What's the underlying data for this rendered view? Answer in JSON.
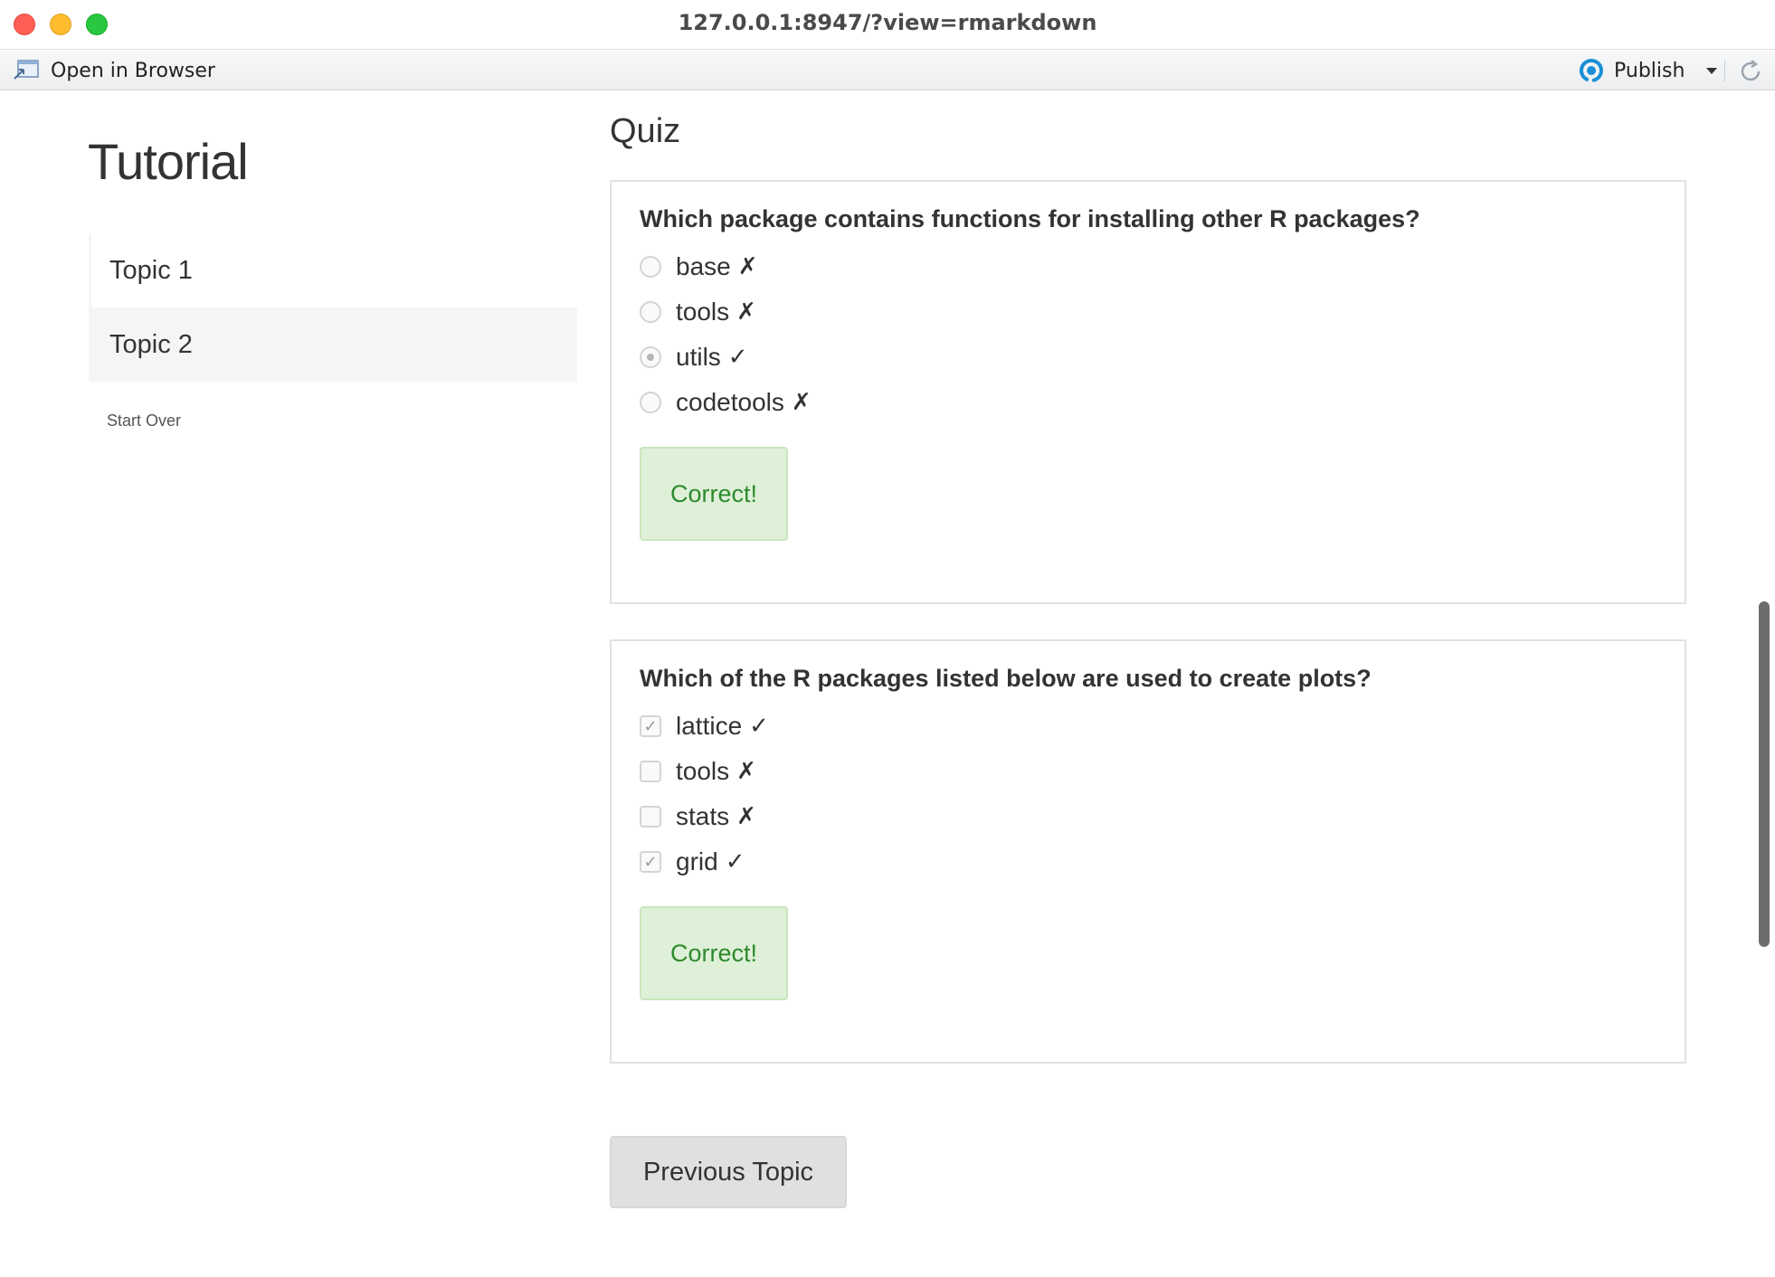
{
  "window": {
    "title": "127.0.0.1:8947/?view=rmarkdown"
  },
  "toolbar": {
    "open_in_browser": "Open in Browser",
    "publish": "Publish"
  },
  "sidebar": {
    "title": "Tutorial",
    "topics": [
      {
        "label": "Topic 1",
        "active": false
      },
      {
        "label": "Topic 2",
        "active": true
      }
    ],
    "start_over": "Start Over"
  },
  "main": {
    "section_title": "Quiz",
    "quizzes": [
      {
        "question": "Which package contains functions for installing other R packages?",
        "type": "radio",
        "answers": [
          {
            "label": "base",
            "mark": "✗",
            "selected": false
          },
          {
            "label": "tools",
            "mark": "✗",
            "selected": false
          },
          {
            "label": "utils",
            "mark": "✓",
            "selected": true
          },
          {
            "label": "codetools",
            "mark": "✗",
            "selected": false
          }
        ],
        "feedback": "Correct!"
      },
      {
        "question": "Which of the R packages listed below are used to create plots?",
        "type": "checkbox",
        "answers": [
          {
            "label": "lattice",
            "mark": "✓",
            "selected": true
          },
          {
            "label": "tools",
            "mark": "✗",
            "selected": false
          },
          {
            "label": "stats",
            "mark": "✗",
            "selected": false
          },
          {
            "label": "grid",
            "mark": "✓",
            "selected": true
          }
        ],
        "feedback": "Correct!"
      }
    ],
    "previous_topic": "Previous Topic"
  },
  "colors": {
    "feedback_bg": "#dff0d8",
    "feedback_text": "#2d8a2d",
    "active_topic_bg": "#f5f5f5",
    "publish_icon": "#1a8fd6"
  },
  "icons": {
    "open_in_browser": "browser-window-icon",
    "publish": "publish-icon",
    "refresh": "refresh-icon"
  }
}
